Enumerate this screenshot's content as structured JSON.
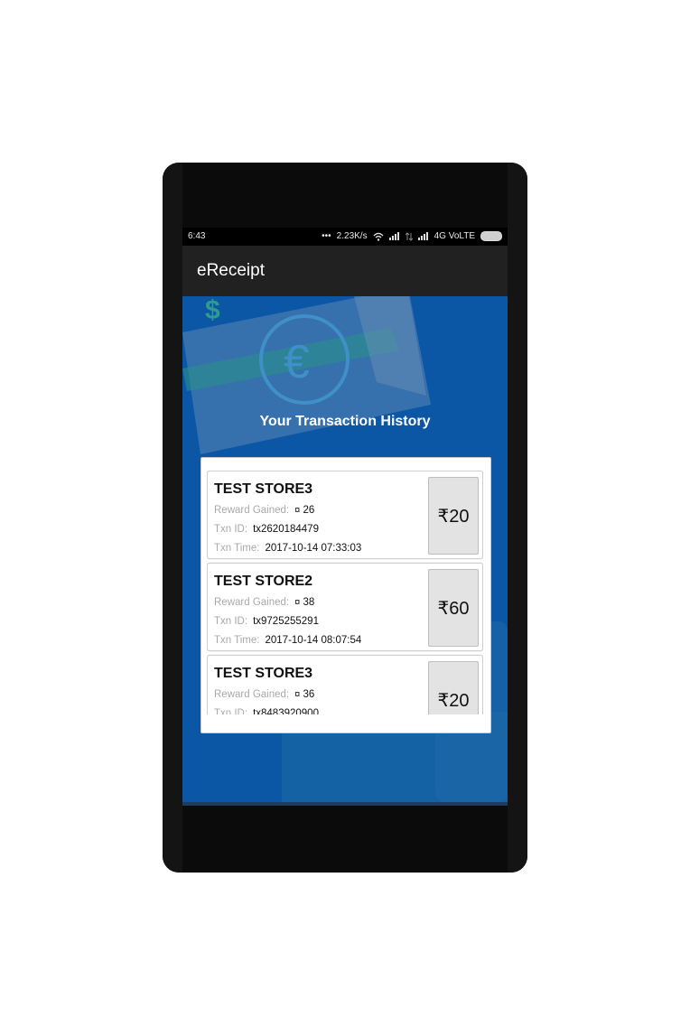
{
  "status_bar": {
    "time": "6:43",
    "network_speed": "2.23K/s",
    "network_type": "4G VoLTE"
  },
  "app_bar": {
    "title": "eReceipt"
  },
  "hero": {
    "heading": "Your Transaction History"
  },
  "labels": {
    "reward": "Reward Gained:",
    "txn_id": "Txn ID:",
    "txn_time": "Txn Time:",
    "reward_icon": "¤"
  },
  "transactions": [
    {
      "store": "TEST STORE3",
      "reward": "26",
      "txn_id": "tx2620184479",
      "txn_time": "2017-10-14 07:33:03",
      "amount": "₹20"
    },
    {
      "store": "TEST STORE2",
      "reward": "38",
      "txn_id": "tx9725255291",
      "txn_time": "2017-10-14 08:07:54",
      "amount": "₹60"
    },
    {
      "store": "TEST STORE3",
      "reward": "36",
      "txn_id": "tx8483920900",
      "txn_time": "",
      "amount": "₹20"
    }
  ],
  "colors": {
    "hero_bg": "#0b57a6",
    "app_bar_bg": "#212121"
  }
}
